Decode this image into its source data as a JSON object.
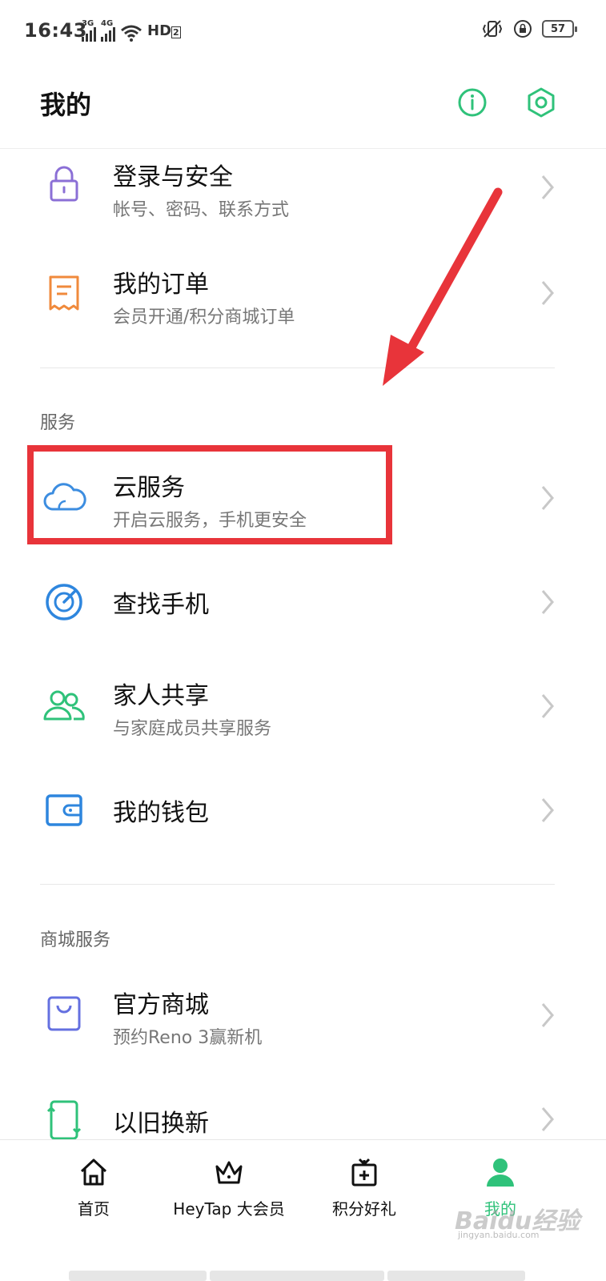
{
  "status_bar": {
    "time": "16:43",
    "network_1": "3G",
    "network_2": "4G",
    "hd_label": "HD",
    "hd_sub": "2",
    "battery": "57"
  },
  "header": {
    "title": "我的",
    "info_icon": "info-icon",
    "settings_icon": "hexagon-settings-icon"
  },
  "account_items": [
    {
      "title": "登录与安全",
      "subtitle": "帐号、密码、联系方式",
      "icon": "lock-icon",
      "color": "#8b6fd6"
    },
    {
      "title": "我的订单",
      "subtitle": "会员开通/积分商城订单",
      "icon": "receipt-icon",
      "color": "#f08a3c"
    }
  ],
  "services": {
    "label": "服务",
    "items": [
      {
        "title": "云服务",
        "subtitle": "开启云服务，手机更安全",
        "icon": "cloud-icon",
        "color": "#3c8de0"
      },
      {
        "title": "查找手机",
        "subtitle": "",
        "icon": "radar-icon",
        "color": "#2e86de"
      },
      {
        "title": "家人共享",
        "subtitle": "与家庭成员共享服务",
        "icon": "family-icon",
        "color": "#2fc27a"
      },
      {
        "title": "我的钱包",
        "subtitle": "",
        "icon": "wallet-icon",
        "color": "#2e86de"
      }
    ]
  },
  "mall_services": {
    "label": "商城服务",
    "items": [
      {
        "title": "官方商城",
        "subtitle": "预约Reno 3赢新机",
        "icon": "shopping-bag-icon",
        "color": "#6470e0"
      },
      {
        "title": "以旧换新",
        "subtitle": "",
        "icon": "trade-in-phone-icon",
        "color": "#2fc27a"
      }
    ]
  },
  "annotation": {
    "highlight_color": "#e8343a",
    "arrow_color": "#e8343a"
  },
  "bottom_nav": [
    {
      "label": "首页",
      "icon": "home-icon",
      "active": false
    },
    {
      "label": "HeyTap 大会员",
      "icon": "crown-icon",
      "active": false
    },
    {
      "label": "积分好礼",
      "icon": "gift-icon",
      "active": false
    },
    {
      "label": "我的",
      "icon": "person-icon",
      "active": true
    }
  ],
  "colors": {
    "accent_green": "#2fc27a",
    "text_primary": "#111111",
    "text_secondary": "#777777"
  },
  "watermark": {
    "main": "Baidu经验",
    "sub": "jingyan.baidu.com"
  }
}
